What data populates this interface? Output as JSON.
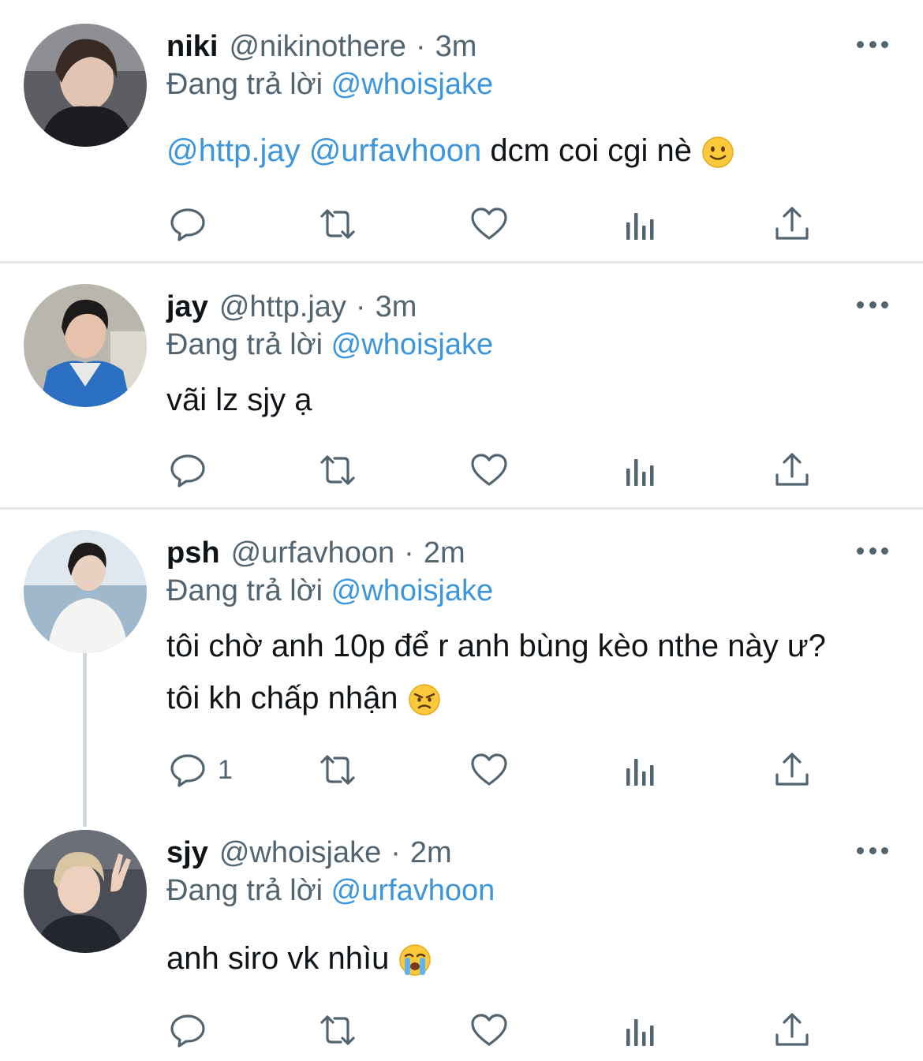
{
  "tweets": [
    {
      "name": "niki",
      "handle": "@nikinothere",
      "separator": "·",
      "time": "3m",
      "reply_prefix": "Đang trả lời",
      "reply_to": "@whoisjake",
      "mention1": "@http.jay",
      "mention2": "@urfavhoon",
      "text": "dcm coi cgi nè",
      "emoji": "slightly-smiling-face-icon"
    },
    {
      "name": "jay",
      "handle": "@http.jay",
      "separator": "·",
      "time": "3m",
      "reply_prefix": "Đang trả lời",
      "reply_to": "@whoisjake",
      "text": "vãi lz sjy ạ"
    },
    {
      "name": "psh",
      "handle": "@urfavhoon",
      "separator": "·",
      "time": "2m",
      "reply_prefix": "Đang trả lời",
      "reply_to": "@whoisjake",
      "text_line1": "tôi chờ anh 10p để r anh bùng kèo nthe này ư?",
      "text_line2": "tôi kh chấp nhận",
      "emoji": "angry-face-icon",
      "reply_count": "1"
    },
    {
      "name": "sjy",
      "handle": "@whoisjake",
      "separator": "·",
      "time": "2m",
      "reply_prefix": "Đang trả lời",
      "reply_to": "@urfavhoon",
      "text": "anh siro vk nhìu",
      "emoji": "loudly-crying-face-icon"
    }
  ],
  "colors": {
    "mention": "#3d95dc",
    "secondary_text": "#536471",
    "divider": "#e4e6e8",
    "thread_line": "#cfd9de"
  },
  "icons": [
    "reply-icon",
    "retweet-icon",
    "like-icon",
    "views-icon",
    "share-icon",
    "more-icon"
  ]
}
